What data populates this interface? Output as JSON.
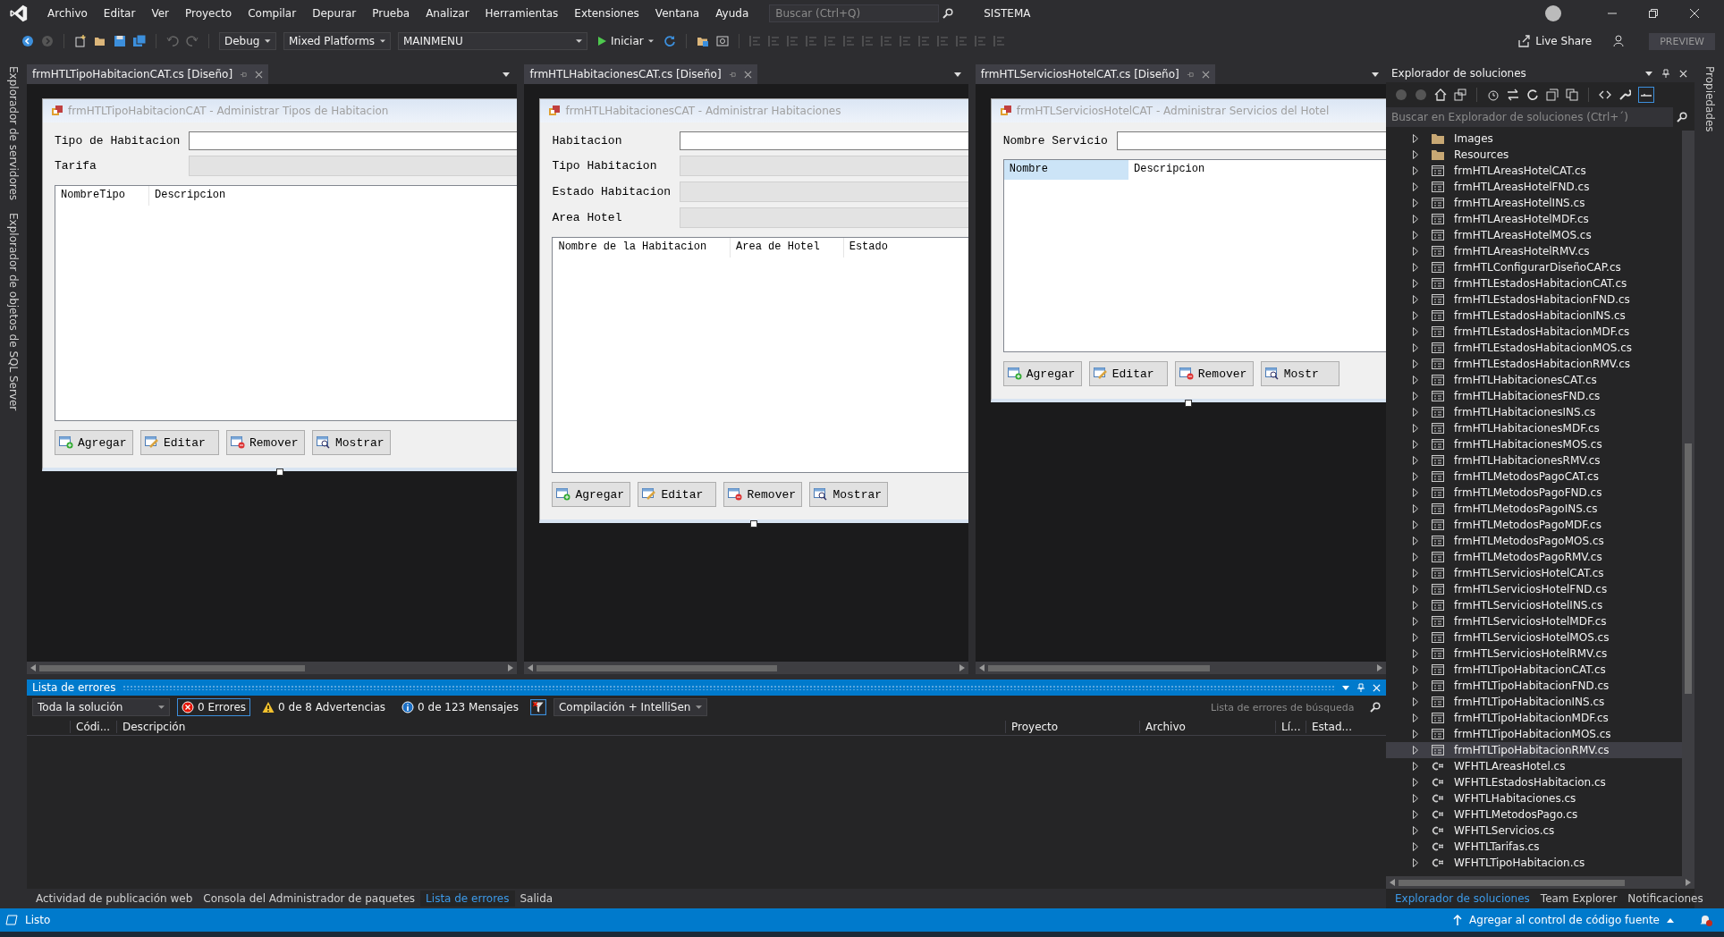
{
  "menu": {
    "items": [
      "Archivo",
      "Editar",
      "Ver",
      "Proyecto",
      "Compilar",
      "Depurar",
      "Prueba",
      "Analizar",
      "Herramientas",
      "Extensiones",
      "Ventana",
      "Ayuda"
    ],
    "search_placeholder": "Buscar (Ctrl+Q)",
    "solution_name": "SISTEMA"
  },
  "toolbar": {
    "configuration": "Debug",
    "platform": "Mixed Platforms",
    "startup_item": "MAINMENU",
    "start_button": "Iniciar",
    "live_share": "Live Share",
    "preview_badge": "PREVIEW"
  },
  "side_tabs_left": [
    "Explorador de servidores",
    "Explorador de objetos de SQL Server"
  ],
  "side_tabs_right": [
    "Propiedades"
  ],
  "documents": [
    {
      "tab": "frmHTLTipoHabitacionCAT.cs [Diseño]",
      "form": {
        "title": "frmHTLTipoHabitacionCAT - Administrar Tipos de Habitacion",
        "fields": [
          {
            "label": "Tipo de Habitacion",
            "kind": "text"
          },
          {
            "label": "Tarifa",
            "kind": "combo"
          }
        ],
        "grid_columns": [
          {
            "label": "NombreTipo",
            "selected": false
          },
          {
            "label": "Descripcion",
            "selected": false
          }
        ],
        "buttons": [
          {
            "label": "Agregar",
            "kind": "add"
          },
          {
            "label": "Editar",
            "kind": "edit"
          },
          {
            "label": "Remover",
            "kind": "remove"
          },
          {
            "label": "Mostrar",
            "kind": "show"
          }
        ]
      }
    },
    {
      "tab": "frmHTLHabitacionesCAT.cs [Diseño]",
      "form": {
        "title": "frmHTLHabitacionesCAT - Administrar Habitaciones",
        "fields": [
          {
            "label": "Habitacion",
            "kind": "text"
          },
          {
            "label": "Tipo Habitacion",
            "kind": "combo"
          },
          {
            "label": "Estado Habitacion",
            "kind": "combo"
          },
          {
            "label": "Area Hotel",
            "kind": "combo"
          }
        ],
        "grid_columns": [
          {
            "label": "Nombre de la Habitacion",
            "selected": false
          },
          {
            "label": "Area de Hotel",
            "selected": false
          },
          {
            "label": "Estado",
            "selected": false
          }
        ],
        "buttons": [
          {
            "label": "Agregar",
            "kind": "add"
          },
          {
            "label": "Editar",
            "kind": "edit"
          },
          {
            "label": "Remover",
            "kind": "remove"
          },
          {
            "label": "Mostrar",
            "kind": "show"
          }
        ]
      }
    },
    {
      "tab": "frmHTLServiciosHotelCAT.cs [Diseño]",
      "form": {
        "title": "frmHTLServiciosHotelCAT - Administrar Servicios del Hotel",
        "fields": [
          {
            "label": "Nombre Servicio",
            "kind": "text"
          }
        ],
        "grid_columns": [
          {
            "label": "Nombre",
            "selected": true
          },
          {
            "label": "Descripcion",
            "selected": false
          }
        ],
        "buttons": [
          {
            "label": "Agregar",
            "kind": "add"
          },
          {
            "label": "Editar",
            "kind": "edit"
          },
          {
            "label": "Remover",
            "kind": "remove"
          },
          {
            "label": "Mostr",
            "kind": "show"
          }
        ]
      }
    }
  ],
  "error_list": {
    "title": "Lista de errores",
    "scope": "Toda la solución",
    "filters": [
      {
        "label": "0 Errores",
        "kind": "error",
        "selected": true
      },
      {
        "label": "0 de 8 Advertencias",
        "kind": "warning",
        "selected": false
      },
      {
        "label": "0 de 123 Mensajes",
        "kind": "info",
        "selected": false
      }
    ],
    "source": "Compilación + IntelliSen",
    "search_placeholder": "Lista de errores de búsqueda",
    "columns": [
      "Códi...",
      "Descripción",
      "Proyecto",
      "Archivo",
      "Lí...",
      "Estad..."
    ]
  },
  "bottom_tabs": [
    {
      "label": "Actividad de publicación web",
      "selected": false
    },
    {
      "label": "Consola del Administrador de paquetes",
      "selected": false
    },
    {
      "label": "Lista de errores",
      "selected": true
    },
    {
      "label": "Salida",
      "selected": false
    }
  ],
  "solution_explorer": {
    "title": "Explorador de soluciones",
    "search_placeholder": "Buscar en Explorador de soluciones (Ctrl+´)",
    "items": [
      {
        "name": "Images",
        "kind": "folder",
        "selected": false
      },
      {
        "name": "Resources",
        "kind": "folder",
        "selected": false
      },
      {
        "name": "frmHTLAreasHotelCAT.cs",
        "kind": "form",
        "selected": false
      },
      {
        "name": "frmHTLAreasHotelFND.cs",
        "kind": "form",
        "selected": false
      },
      {
        "name": "frmHTLAreasHotelINS.cs",
        "kind": "form",
        "selected": false
      },
      {
        "name": "frmHTLAreasHotelMDF.cs",
        "kind": "form",
        "selected": false
      },
      {
        "name": "frmHTLAreasHotelMOS.cs",
        "kind": "form",
        "selected": false
      },
      {
        "name": "frmHTLAreasHotelRMV.cs",
        "kind": "form",
        "selected": false
      },
      {
        "name": "frmHTLConfigurarDiseñoCAP.cs",
        "kind": "form",
        "selected": false
      },
      {
        "name": "frmHTLEstadosHabitacionCAT.cs",
        "kind": "form",
        "selected": false
      },
      {
        "name": "frmHTLEstadosHabitacionFND.cs",
        "kind": "form",
        "selected": false
      },
      {
        "name": "frmHTLEstadosHabitacionINS.cs",
        "kind": "form",
        "selected": false
      },
      {
        "name": "frmHTLEstadosHabitacionMDF.cs",
        "kind": "form",
        "selected": false
      },
      {
        "name": "frmHTLEstadosHabitacionMOS.cs",
        "kind": "form",
        "selected": false
      },
      {
        "name": "frmHTLEstadosHabitacionRMV.cs",
        "kind": "form",
        "selected": false
      },
      {
        "name": "frmHTLHabitacionesCAT.cs",
        "kind": "form",
        "selected": false
      },
      {
        "name": "frmHTLHabitacionesFND.cs",
        "kind": "form",
        "selected": false
      },
      {
        "name": "frmHTLHabitacionesINS.cs",
        "kind": "form",
        "selected": false
      },
      {
        "name": "frmHTLHabitacionesMDF.cs",
        "kind": "form",
        "selected": false
      },
      {
        "name": "frmHTLHabitacionesMOS.cs",
        "kind": "form",
        "selected": false
      },
      {
        "name": "frmHTLHabitacionesRMV.cs",
        "kind": "form",
        "selected": false
      },
      {
        "name": "frmHTLMetodosPagoCAT.cs",
        "kind": "form",
        "selected": false
      },
      {
        "name": "frmHTLMetodosPagoFND.cs",
        "kind": "form",
        "selected": false
      },
      {
        "name": "frmHTLMetodosPagoINS.cs",
        "kind": "form",
        "selected": false
      },
      {
        "name": "frmHTLMetodosPagoMDF.cs",
        "kind": "form",
        "selected": false
      },
      {
        "name": "frmHTLMetodosPagoMOS.cs",
        "kind": "form",
        "selected": false
      },
      {
        "name": "frmHTLMetodosPagoRMV.cs",
        "kind": "form",
        "selected": false
      },
      {
        "name": "frmHTLServiciosHotelCAT.cs",
        "kind": "form",
        "selected": false
      },
      {
        "name": "frmHTLServiciosHotelFND.cs",
        "kind": "form",
        "selected": false
      },
      {
        "name": "frmHTLServiciosHotelINS.cs",
        "kind": "form",
        "selected": false
      },
      {
        "name": "frmHTLServiciosHotelMDF.cs",
        "kind": "form",
        "selected": false
      },
      {
        "name": "frmHTLServiciosHotelMOS.cs",
        "kind": "form",
        "selected": false
      },
      {
        "name": "frmHTLServiciosHotelRMV.cs",
        "kind": "form",
        "selected": false
      },
      {
        "name": "frmHTLTipoHabitacionCAT.cs",
        "kind": "form",
        "selected": false
      },
      {
        "name": "frmHTLTipoHabitacionFND.cs",
        "kind": "form",
        "selected": false
      },
      {
        "name": "frmHTLTipoHabitacionINS.cs",
        "kind": "form",
        "selected": false
      },
      {
        "name": "frmHTLTipoHabitacionMDF.cs",
        "kind": "form",
        "selected": false
      },
      {
        "name": "frmHTLTipoHabitacionMOS.cs",
        "kind": "form",
        "selected": false
      },
      {
        "name": "frmHTLTipoHabitacionRMV.cs",
        "kind": "form",
        "selected": true
      },
      {
        "name": "WFHTLAreasHotel.cs",
        "kind": "csharp",
        "selected": false
      },
      {
        "name": "WFHTLEstadosHabitacion.cs",
        "kind": "csharp",
        "selected": false
      },
      {
        "name": "WFHTLHabitaciones.cs",
        "kind": "csharp",
        "selected": false
      },
      {
        "name": "WFHTLMetodosPago.cs",
        "kind": "csharp",
        "selected": false
      },
      {
        "name": "WFHTLServicios.cs",
        "kind": "csharp",
        "selected": false
      },
      {
        "name": "WFHTLTarifas.cs",
        "kind": "csharp",
        "selected": false
      },
      {
        "name": "WFHTLTipoHabitacion.cs",
        "kind": "csharp",
        "selected": false
      }
    ],
    "tabs": [
      {
        "label": "Explorador de soluciones",
        "selected": true
      },
      {
        "label": "Team Explorer",
        "selected": false
      },
      {
        "label": "Notificaciones",
        "selected": false
      }
    ]
  },
  "status_bar": {
    "text": "Listo",
    "source_control": "Agregar al control de código fuente"
  }
}
